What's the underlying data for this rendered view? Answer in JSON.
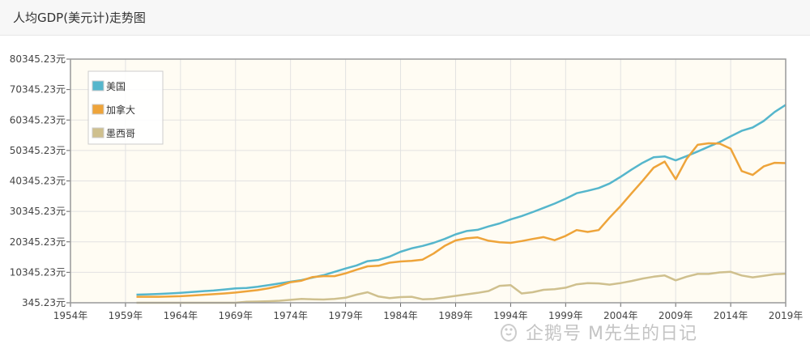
{
  "header": {
    "title": "人均GDP(美元计)走势图"
  },
  "watermark": {
    "text": "企鹅号 M先生的日记",
    "icon": "penguin-logo-icon"
  },
  "colors": {
    "us": "#55b6cc",
    "canada": "#eea43a",
    "mexico": "#cfc08e",
    "plot_bg": "#fffcf3",
    "grid": "#e2e2e2",
    "frame": "#999999"
  },
  "chart_data": {
    "type": "line",
    "title": "",
    "xlabel": "",
    "ylabel": "",
    "xlim": [
      1954,
      2019
    ],
    "ylim": [
      345.23,
      80345.23
    ],
    "grid": true,
    "legend_position": "top-left",
    "x_ticks": [
      "1954年",
      "1959年",
      "1964年",
      "1969年",
      "1974年",
      "1979年",
      "1984年",
      "1989年",
      "1994年",
      "1999年",
      "2004年",
      "2009年",
      "2014年",
      "2019年"
    ],
    "y_ticks": [
      "345.23元",
      "10345.23元",
      "20345.23元",
      "30345.23元",
      "40345.23元",
      "50345.23元",
      "60345.23元",
      "70345.23元",
      "80345.23元"
    ],
    "x": [
      1960,
      1961,
      1962,
      1963,
      1964,
      1965,
      1966,
      1967,
      1968,
      1969,
      1970,
      1971,
      1972,
      1973,
      1974,
      1975,
      1976,
      1977,
      1978,
      1979,
      1980,
      1981,
      1982,
      1983,
      1984,
      1985,
      1986,
      1987,
      1988,
      1989,
      1990,
      1991,
      1992,
      1993,
      1994,
      1995,
      1996,
      1997,
      1998,
      1999,
      2000,
      2001,
      2002,
      2003,
      2004,
      2005,
      2006,
      2007,
      2008,
      2009,
      2010,
      2011,
      2012,
      2013,
      2014,
      2015,
      2016,
      2017,
      2018,
      2019
    ],
    "series": [
      {
        "name": "美国",
        "color": "#55b6cc",
        "values": [
          3000,
          3100,
          3250,
          3400,
          3600,
          3850,
          4150,
          4350,
          4700,
          5050,
          5200,
          5600,
          6100,
          6700,
          7250,
          7800,
          8600,
          9400,
          10500,
          11600,
          12600,
          14000,
          14400,
          15500,
          17100,
          18200,
          19000,
          20000,
          21300,
          22800,
          23900,
          24300,
          25400,
          26400,
          27700,
          28800,
          30100,
          31500,
          32900,
          34500,
          36300,
          37100,
          38000,
          39500,
          41700,
          44100,
          46300,
          48100,
          48400,
          47100,
          48500,
          50000,
          51600,
          53100,
          55000,
          56800,
          57900,
          60000,
          63000,
          65300
        ]
      },
      {
        "name": "加拿大",
        "color": "#eea43a",
        "values": [
          2300,
          2300,
          2300,
          2400,
          2500,
          2700,
          2950,
          3150,
          3400,
          3700,
          4100,
          4500,
          5100,
          5900,
          7100,
          7600,
          8800,
          9100,
          9100,
          10000,
          11200,
          12300,
          12500,
          13500,
          13900,
          14100,
          14500,
          16500,
          19000,
          20800,
          21500,
          21800,
          20700,
          20200,
          20000,
          20600,
          21300,
          21900,
          20900,
          22300,
          24200,
          23600,
          24200,
          28300,
          32100,
          36300,
          40400,
          44700,
          46700,
          40900,
          47600,
          52200,
          52700,
          52600,
          50900,
          43600,
          42300,
          45100,
          46300,
          46200
        ]
      },
      {
        "name": "墨西哥",
        "color": "#cfc08e",
        "values": [
          345,
          345,
          345,
          345,
          345,
          345,
          345,
          345,
          345,
          345,
          700,
          750,
          850,
          1000,
          1300,
          1600,
          1500,
          1400,
          1600,
          2000,
          3000,
          3800,
          2400,
          1900,
          2200,
          2300,
          1500,
          1600,
          2100,
          2600,
          3100,
          3600,
          4200,
          5900,
          6100,
          3400,
          3800,
          4600,
          4800,
          5300,
          6400,
          6800,
          6700,
          6300,
          6800,
          7500,
          8300,
          8900,
          9300,
          7700,
          8900,
          9800,
          9800,
          10300,
          10500,
          9300,
          8700,
          9200,
          9700,
          9900
        ]
      }
    ]
  }
}
